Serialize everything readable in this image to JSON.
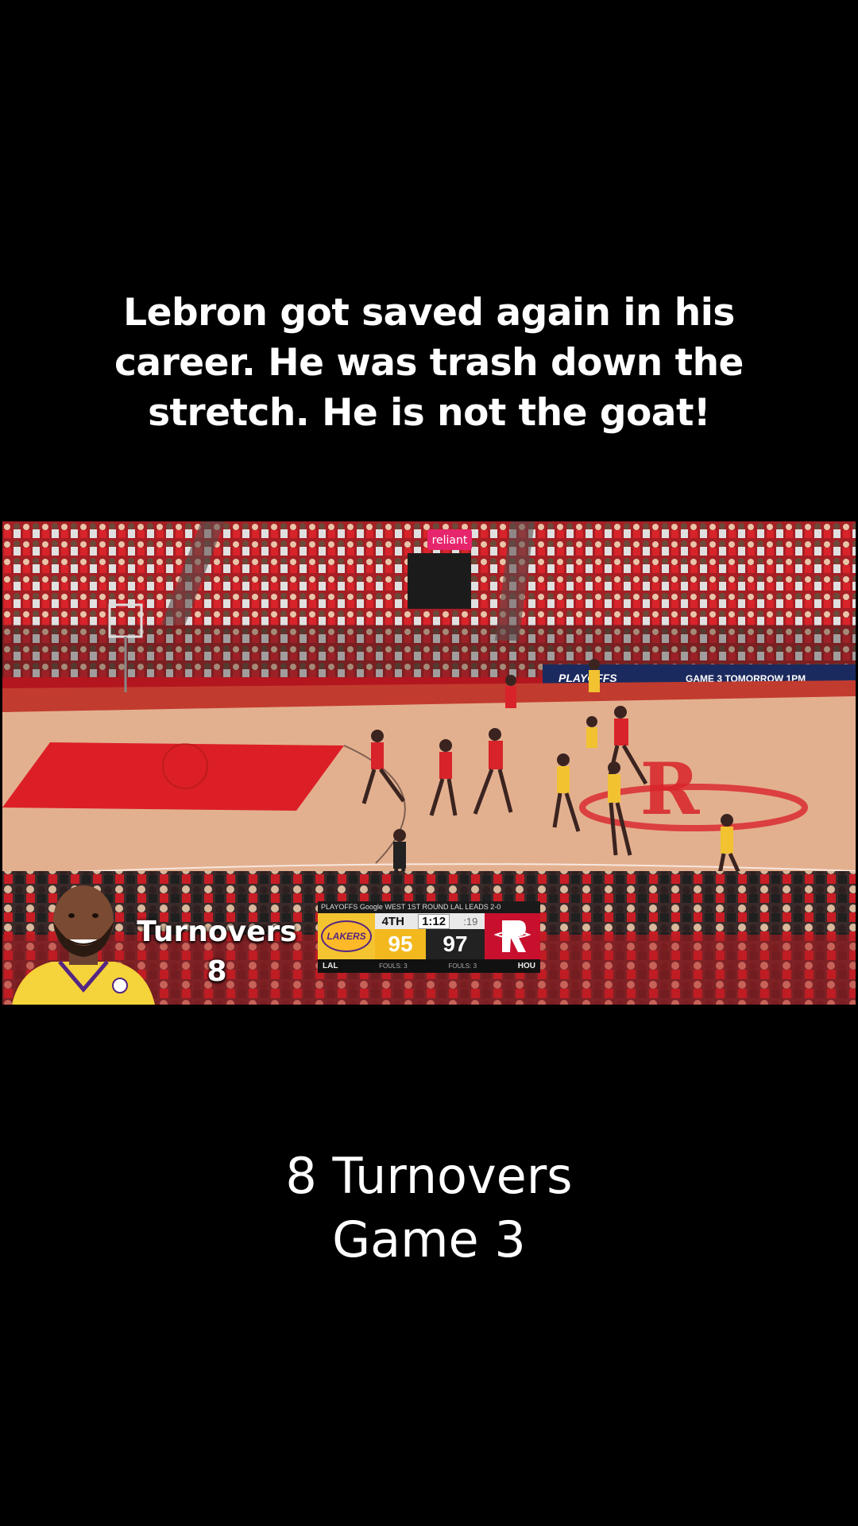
{
  "caption_top": "Lebron got saved again in his career. He was trash down the stretch. He is not the goat!",
  "overlay": {
    "stat_label": "Turnovers",
    "stat_value": "8",
    "player_icon": "lebron-james-avatar"
  },
  "scoreboard": {
    "top_line": "PLAYOFFS Google  WEST 1ST ROUND  LAL LEADS 2-0",
    "quarter": "4TH",
    "game_clock": "1:12",
    "shot_clock": ":19",
    "away": {
      "abbr": "LAL",
      "score": "95",
      "fouls": "FOULS: 3",
      "logo": "LAKERS",
      "color": "#f2b81e"
    },
    "home": {
      "abbr": "HOU",
      "score": "97",
      "fouls": "FOULS: 3",
      "color": "#c8102e"
    }
  },
  "arena_signage": {
    "top_sign": "reliant",
    "ribbon_left": "PLAYOFFS",
    "ribbon_right": "GAME 3   TOMORROW 1PM"
  },
  "caption_bottom": {
    "line1": "8 Turnovers",
    "line2": "Game 3"
  }
}
